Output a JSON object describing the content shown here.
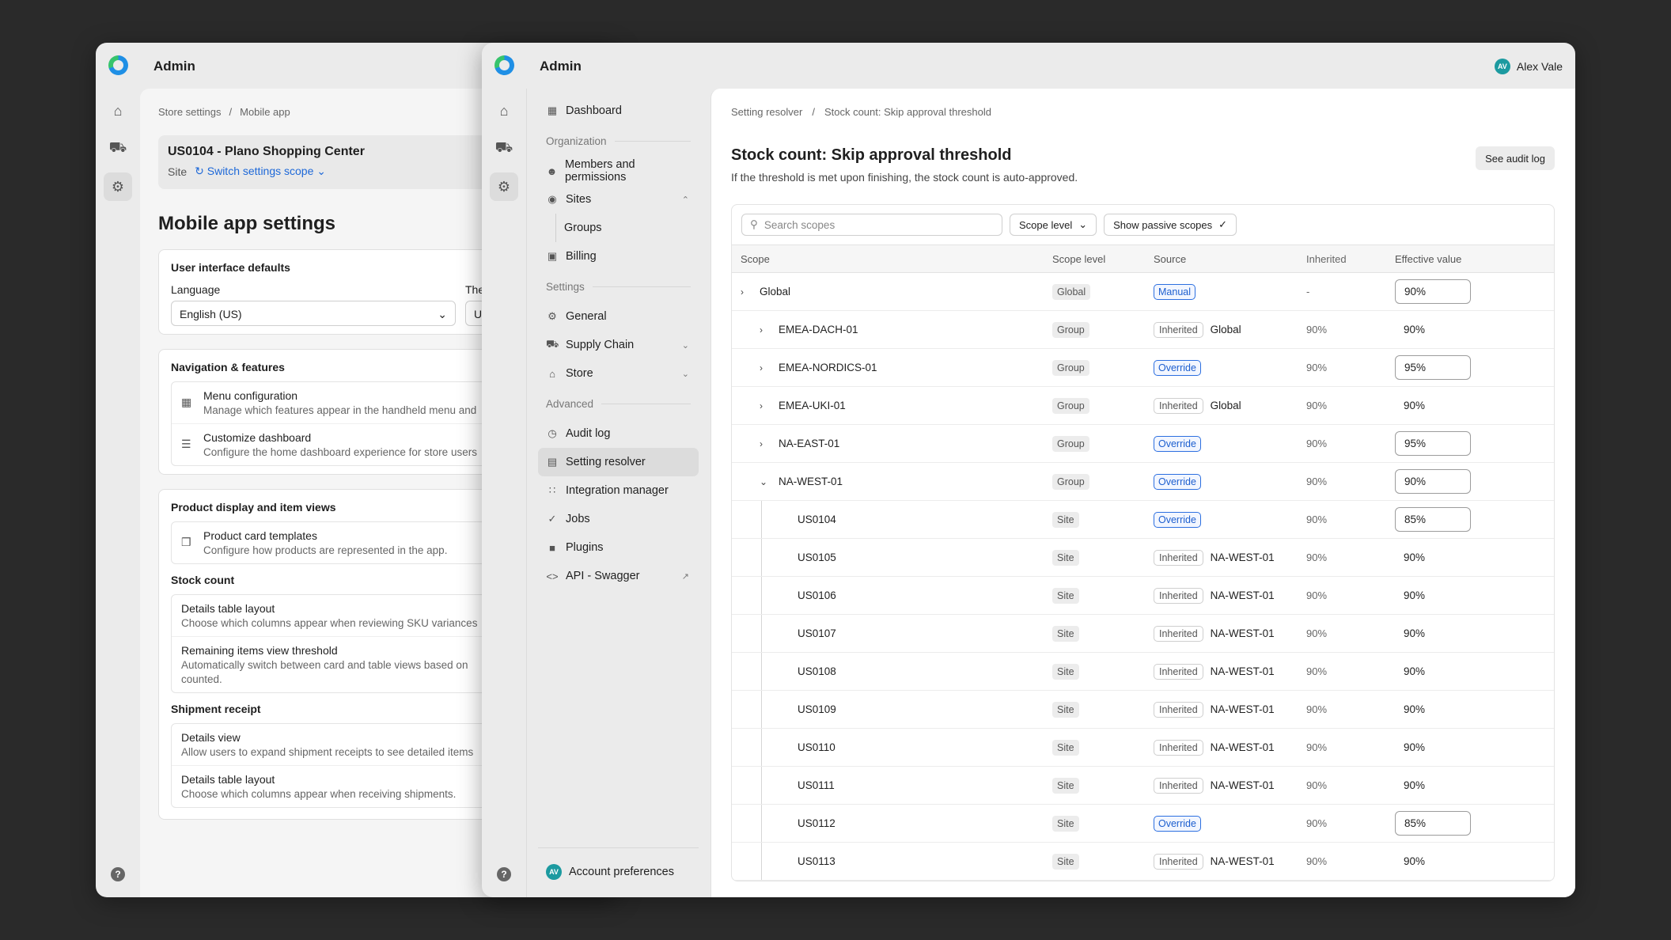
{
  "window_back": {
    "app_title": "Admin",
    "breadcrumb": [
      "Store settings",
      "Mobile app"
    ],
    "site": {
      "name": "US0104 - Plano Shopping Center",
      "type": "Site",
      "switch_label": "Switch settings scope"
    },
    "page_title": "Mobile app settings",
    "ui_defaults": {
      "title": "User interface defaults",
      "language_label": "Language",
      "language_value": "English (US)",
      "theme_label_partial": "The"
    },
    "navigation": {
      "title": "Navigation & features",
      "items": [
        {
          "title": "Menu configuration",
          "desc": "Manage which features appear in the handheld menu and"
        },
        {
          "title": "Customize dashboard",
          "desc": "Configure the home dashboard experience for store users"
        }
      ]
    },
    "product": {
      "title": "Product display and item views",
      "items": [
        {
          "title": "Product card templates",
          "desc": "Configure how products are represented in the app."
        }
      ]
    },
    "stock_count": {
      "title": "Stock count",
      "items": [
        {
          "title": "Details table layout",
          "desc": "Choose which columns appear when reviewing SKU variances"
        },
        {
          "title": "Remaining items view threshold",
          "desc": "Automatically switch between card and table views based on",
          "desc2": "counted."
        }
      ]
    },
    "shipment": {
      "title": "Shipment receipt",
      "items": [
        {
          "title": "Details view",
          "desc": "Allow users to expand shipment receipts to see detailed items"
        },
        {
          "title": "Details table layout",
          "desc": "Choose which columns appear when receiving shipments."
        }
      ]
    }
  },
  "window_front": {
    "app_title": "Admin",
    "user": {
      "initials": "AV",
      "name": "Alex Vale"
    },
    "nav": {
      "dashboard": "Dashboard",
      "org_section": "Organization",
      "members": "Members and permissions",
      "sites": "Sites",
      "groups": "Groups",
      "billing": "Billing",
      "settings_section": "Settings",
      "general": "General",
      "supply_chain": "Supply Chain",
      "store": "Store",
      "advanced_section": "Advanced",
      "audit_log": "Audit log",
      "setting_resolver": "Setting resolver",
      "integration_manager": "Integration manager",
      "jobs": "Jobs",
      "plugins": "Plugins",
      "api": "API - Swagger",
      "account": "Account preferences"
    },
    "breadcrumb": [
      "Setting resolver",
      "Stock count: Skip approval threshold"
    ],
    "title": "Stock count: Skip approval threshold",
    "description": "If the threshold is met upon finishing, the stock count is auto-approved.",
    "audit_button": "See audit log",
    "search_placeholder": "Search scopes",
    "filter_scope_level": "Scope level",
    "filter_passive": "Show passive scopes",
    "columns": [
      "Scope",
      "Scope level",
      "Source",
      "Inherited",
      "Effective value"
    ],
    "rows": [
      {
        "scope": "Global",
        "level": "Global",
        "source": "Manual",
        "from": "",
        "inherited": "-",
        "value": "90%"
      },
      {
        "scope": "EMEA-DACH-01",
        "level": "Group",
        "source": "Inherited",
        "from": "Global",
        "inherited": "90%",
        "value": "90%"
      },
      {
        "scope": "EMEA-NORDICS-01",
        "level": "Group",
        "source": "Override",
        "from": "",
        "inherited": "90%",
        "value": "95%"
      },
      {
        "scope": "EMEA-UKI-01",
        "level": "Group",
        "source": "Inherited",
        "from": "Global",
        "inherited": "90%",
        "value": "90%"
      },
      {
        "scope": "NA-EAST-01",
        "level": "Group",
        "source": "Override",
        "from": "",
        "inherited": "90%",
        "value": "95%"
      },
      {
        "scope": "NA-WEST-01",
        "level": "Group",
        "source": "Override",
        "from": "",
        "inherited": "90%",
        "value": "90%"
      },
      {
        "scope": "US0104",
        "level": "Site",
        "source": "Override",
        "from": "",
        "inherited": "90%",
        "value": "85%"
      },
      {
        "scope": "US0105",
        "level": "Site",
        "source": "Inherited",
        "from": "NA-WEST-01",
        "inherited": "90%",
        "value": "90%"
      },
      {
        "scope": "US0106",
        "level": "Site",
        "source": "Inherited",
        "from": "NA-WEST-01",
        "inherited": "90%",
        "value": "90%"
      },
      {
        "scope": "US0107",
        "level": "Site",
        "source": "Inherited",
        "from": "NA-WEST-01",
        "inherited": "90%",
        "value": "90%"
      },
      {
        "scope": "US0108",
        "level": "Site",
        "source": "Inherited",
        "from": "NA-WEST-01",
        "inherited": "90%",
        "value": "90%"
      },
      {
        "scope": "US0109",
        "level": "Site",
        "source": "Inherited",
        "from": "NA-WEST-01",
        "inherited": "90%",
        "value": "90%"
      },
      {
        "scope": "US0110",
        "level": "Site",
        "source": "Inherited",
        "from": "NA-WEST-01",
        "inherited": "90%",
        "value": "90%"
      },
      {
        "scope": "US0111",
        "level": "Site",
        "source": "Inherited",
        "from": "NA-WEST-01",
        "inherited": "90%",
        "value": "90%"
      },
      {
        "scope": "US0112",
        "level": "Site",
        "source": "Override",
        "from": "",
        "inherited": "90%",
        "value": "85%"
      },
      {
        "scope": "US0113",
        "level": "Site",
        "source": "Inherited",
        "from": "NA-WEST-01",
        "inherited": "90%",
        "value": "90%"
      }
    ]
  }
}
